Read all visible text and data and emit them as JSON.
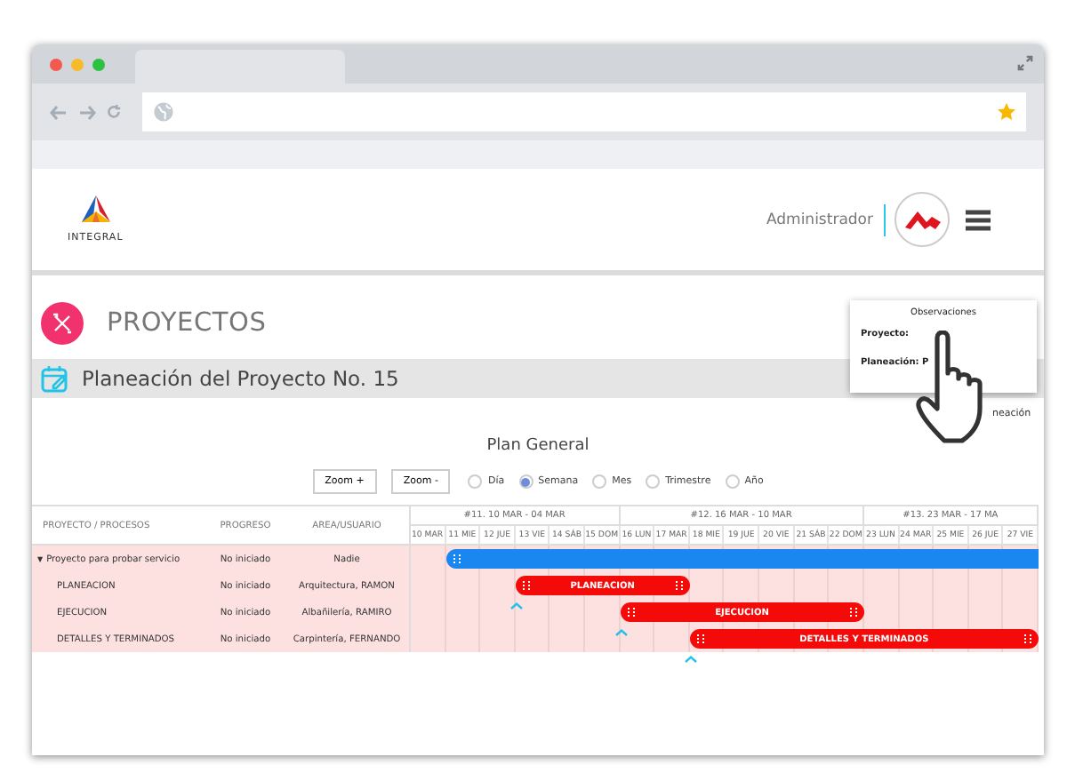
{
  "header": {
    "logo_text": "INTEGRAL",
    "user": "Administrador"
  },
  "page_title": "PROYECTOS",
  "subtitle": "Planeación del Proyecto No. 15",
  "popup": {
    "title": "Observaciones",
    "lines": [
      "Proyecto:",
      "Planeación: P"
    ]
  },
  "side_label": "neación",
  "plan": {
    "title": "Plan General",
    "buttons": [
      "Zoom +",
      "Zoom -"
    ],
    "scales": [
      {
        "label": "Día",
        "selected": false
      },
      {
        "label": "Semana",
        "selected": true
      },
      {
        "label": "Mes",
        "selected": false
      },
      {
        "label": "Trimestre",
        "selected": false
      },
      {
        "label": "Año",
        "selected": false
      }
    ]
  },
  "gantt": {
    "columns": [
      "PROYECTO / PROCESOS",
      "PROGRESO",
      "AREA/USUARIO"
    ],
    "weeks": [
      "#11. 10 MAR - 04 MAR",
      "#12. 16 MAR - 10 MAR",
      "#13. 23 MAR - 17 MA"
    ],
    "days": [
      "10 MAR",
      "11 MIE",
      "12 JUE",
      "13 VIE",
      "14 SÁB",
      "15 DOM",
      "16 LUN",
      "17 MAR",
      "18 MIE",
      "19 JUE",
      "20 VIE",
      "21 SÁB",
      "22 DOM",
      "23 LUN",
      "24 MAR",
      "25 MIE",
      "26 JUE",
      "27 VIE"
    ],
    "rows": [
      {
        "kind": "project",
        "toggle": "▼",
        "expanded": true,
        "name": "Proyecto para probar servicio",
        "progress": "No iniciado",
        "area": "Nadie"
      },
      {
        "kind": "task",
        "name": "PLANEACION",
        "progress": "No iniciado",
        "area": "Arquitectura, RAMON",
        "bar_label": "PLANEACION"
      },
      {
        "kind": "task",
        "name": "EJECUCION",
        "progress": "No iniciado",
        "area": "Albañilería, RAMIRO",
        "bar_label": "EJECUCION"
      },
      {
        "kind": "task",
        "name": "DETALLES Y TERMINADOS",
        "progress": "No iniciado",
        "area": "Carpintería, FERNANDO",
        "bar_label": "DETALLES Y TERMINADOS"
      }
    ]
  }
}
